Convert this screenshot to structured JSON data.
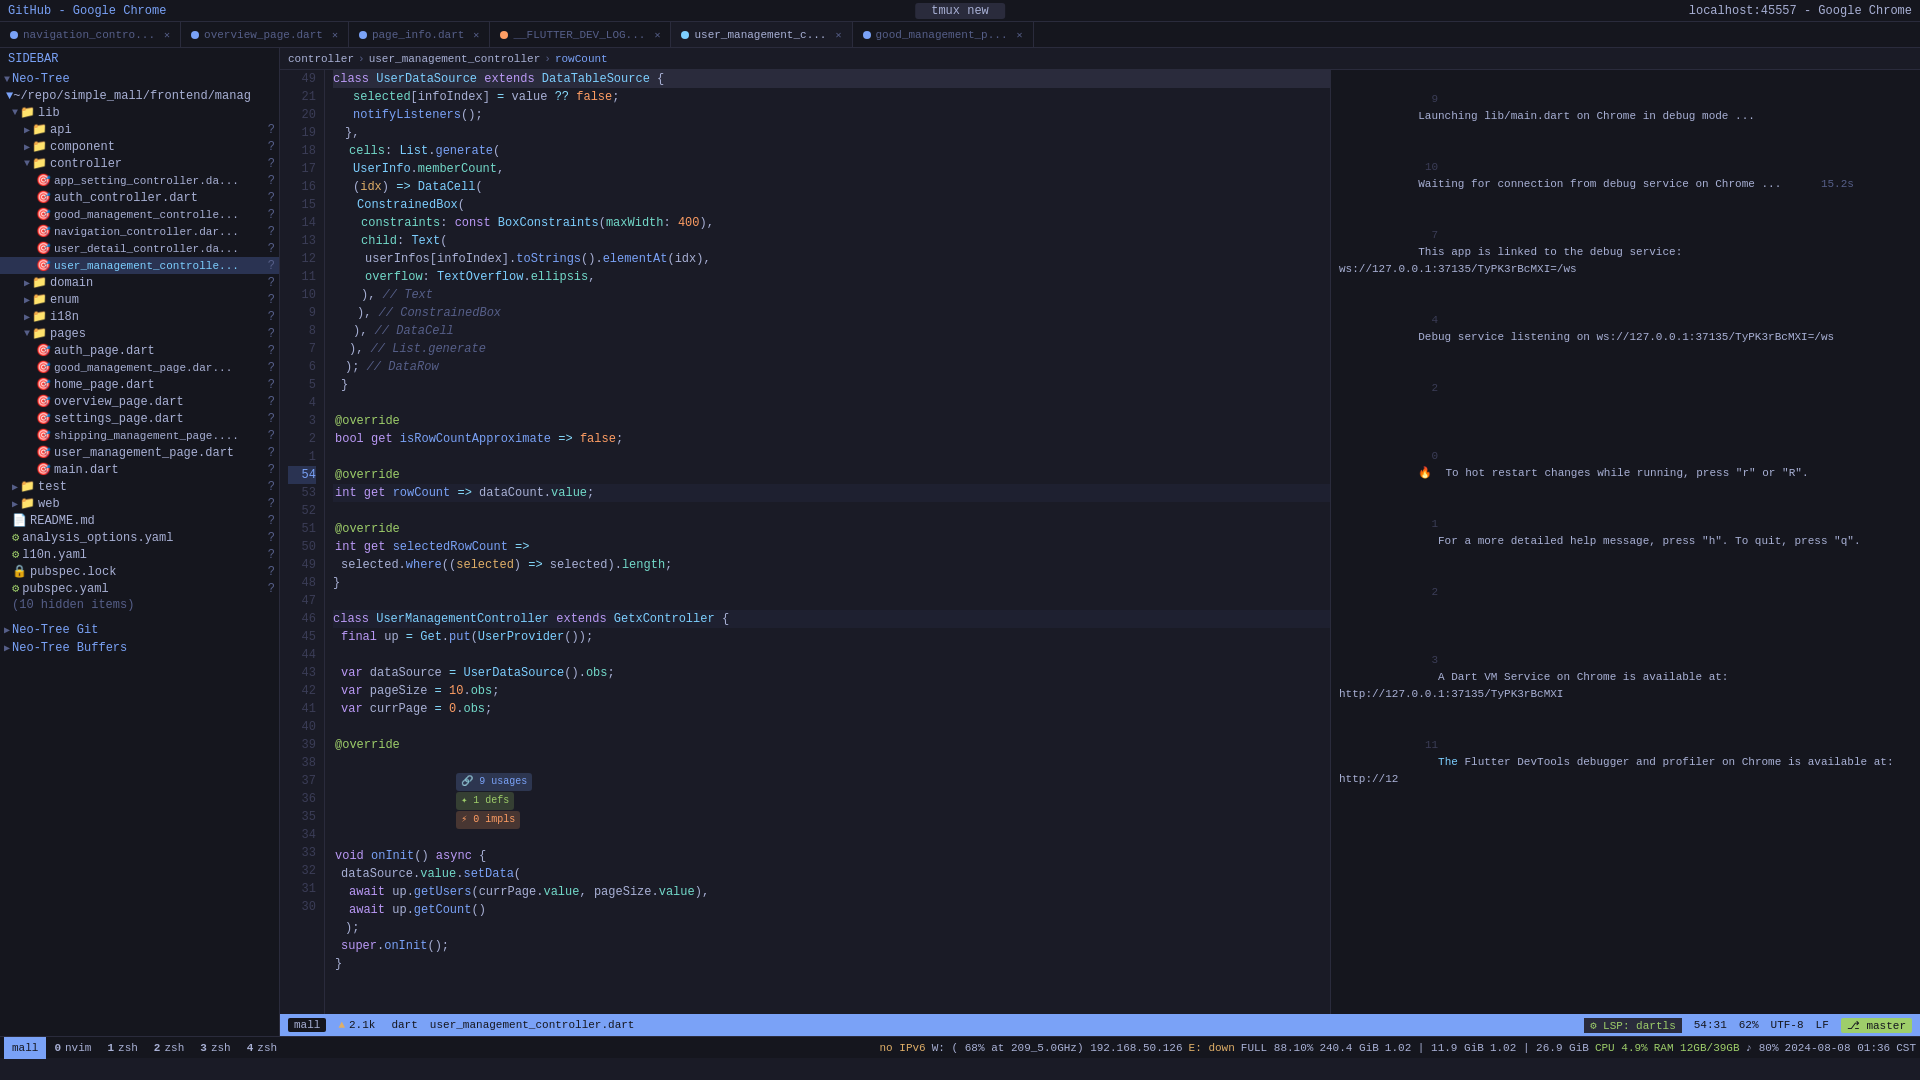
{
  "window": {
    "title_left": "GitHub - Google Chrome",
    "title_center": "tmux new",
    "title_right": "localhost:45557 - Google Chrome"
  },
  "tabs": [
    {
      "id": "nav_ctrl",
      "label": "navigation_contro...",
      "dot": "blue",
      "active": false
    },
    {
      "id": "overview",
      "label": "overview_page.dart",
      "dot": "blue",
      "active": false
    },
    {
      "id": "page_info",
      "label": "page_info.dart",
      "dot": "blue",
      "active": false
    },
    {
      "id": "flutter_dev",
      "label": "__FLUTTER_DEV_LOG...",
      "dot": "orange",
      "active": false
    },
    {
      "id": "user_mgmt_c",
      "label": "user_management_c...",
      "dot": "active",
      "active": true
    },
    {
      "id": "good_mgmt",
      "label": "good_management_p...",
      "dot": "blue",
      "active": false
    }
  ],
  "sidebar": {
    "header": "Sidebar",
    "tree_header": "Neo-Tree",
    "git_section": "Neo-Tree Git",
    "buffer_section": "Neo-Tree Buffers",
    "root": "~/repo/simple_mall/frontend/manag",
    "items": [
      {
        "level": 1,
        "label": "lib",
        "type": "folder",
        "expanded": true
      },
      {
        "level": 2,
        "label": "api",
        "type": "folder",
        "expanded": false,
        "q": true
      },
      {
        "level": 2,
        "label": "component",
        "type": "folder",
        "expanded": false,
        "q": true
      },
      {
        "level": 2,
        "label": "controller",
        "type": "folder",
        "expanded": true,
        "q": true
      },
      {
        "level": 3,
        "label": "app_setting_controller.da...",
        "type": "dart",
        "q": true
      },
      {
        "level": 3,
        "label": "auth_controller.dart",
        "type": "dart",
        "q": true
      },
      {
        "level": 3,
        "label": "good_management_controlle...",
        "type": "dart",
        "q": true
      },
      {
        "level": 3,
        "label": "navigation_controller.dar...",
        "type": "dart",
        "q": true
      },
      {
        "level": 3,
        "label": "user_detail_controller.da...",
        "type": "dart",
        "q": true
      },
      {
        "level": 3,
        "label": "user_management_controlle...",
        "type": "dart",
        "active": true,
        "q": true
      },
      {
        "level": 2,
        "label": "domain",
        "type": "folder",
        "expanded": false,
        "q": true
      },
      {
        "level": 2,
        "label": "enum",
        "type": "folder",
        "expanded": false,
        "q": true
      },
      {
        "level": 2,
        "label": "i18n",
        "type": "folder",
        "expanded": false,
        "q": true
      },
      {
        "level": 2,
        "label": "pages",
        "type": "folder",
        "expanded": true,
        "q": true
      },
      {
        "level": 3,
        "label": "auth_page.dart",
        "type": "dart",
        "q": true
      },
      {
        "level": 3,
        "label": "good_management_page.dar...",
        "type": "dart",
        "q": true
      },
      {
        "level": 3,
        "label": "home_page.dart",
        "type": "dart",
        "q": true
      },
      {
        "level": 3,
        "label": "overview_page.dart",
        "type": "dart",
        "q": true
      },
      {
        "level": 3,
        "label": "settings_page.dart",
        "type": "dart",
        "q": true
      },
      {
        "level": 3,
        "label": "shipping_management_page....",
        "type": "dart",
        "q": true
      },
      {
        "level": 3,
        "label": "user_management_page.dart",
        "type": "dart",
        "q": true
      },
      {
        "level": 2,
        "label": "main.dart",
        "type": "dart",
        "q": true
      },
      {
        "level": 1,
        "label": "test",
        "type": "folder",
        "expanded": false,
        "q": true
      },
      {
        "level": 1,
        "label": "web",
        "type": "folder",
        "expanded": false,
        "q": true
      },
      {
        "level": 1,
        "label": "README.md",
        "type": "md",
        "q": true
      },
      {
        "level": 1,
        "label": "analysis_options.yaml",
        "type": "yaml",
        "q": true
      },
      {
        "level": 1,
        "label": "l10n.yaml",
        "type": "yaml",
        "q": true
      },
      {
        "level": 1,
        "label": "pubspec.lock",
        "type": "lock",
        "q": true
      },
      {
        "level": 1,
        "label": "pubspec.yaml",
        "type": "yaml",
        "q": true
      },
      {
        "level": 0,
        "label": "(10 hidden items)",
        "type": "info"
      }
    ]
  },
  "breadcrumb": {
    "controller": "controller",
    "user_management": "user_management_controller",
    "rowCount": "rowCount"
  },
  "editor": {
    "filename": "user_management_controller.dart",
    "cursor_line": 54,
    "cursor_col": 31,
    "scroll_percent": 62
  },
  "code_lines": [
    {
      "num": 9,
      "content": "selected[infoIndex] = value ?? false;"
    },
    {
      "num": 21,
      "content": "notifyListeners();"
    },
    {
      "num": 20,
      "content": "},"
    },
    {
      "num": 19,
      "content": "cells: List.generate("
    },
    {
      "num": 18,
      "content": "UserInfo.memberCount,"
    },
    {
      "num": 17,
      "content": "(idx) => DataCell("
    },
    {
      "num": 16,
      "content": "ConstrainedBox("
    },
    {
      "num": 15,
      "content": "constraints: const BoxConstraints(maxWidth: 400),"
    },
    {
      "num": 14,
      "content": "child: Text("
    },
    {
      "num": 13,
      "content": "userInfos[infoIndex].toStrings().elementAt(idx),"
    },
    {
      "num": 12,
      "content": "overflow: TextOverflow.ellipsis,"
    },
    {
      "num": 11,
      "content": "), // Text"
    },
    {
      "num": 10,
      "content": "), // ConstrainedBox"
    },
    {
      "num": 9,
      "content": "), // DataCell"
    },
    {
      "num": 8,
      "content": "), // List.generate"
    },
    {
      "num": 7,
      "content": "); // DataRow"
    },
    {
      "num": 6,
      "content": "}"
    },
    {
      "num": 5,
      "content": ""
    },
    {
      "num": 4,
      "content": "@override"
    },
    {
      "num": 3,
      "content": "bool get isRowCountApproximate => false;"
    },
    {
      "num": 2,
      "content": ""
    },
    {
      "num": 1,
      "content": "@override"
    },
    {
      "num": 54,
      "content": "int get rowCount => dataCount.value;"
    },
    {
      "num": 53,
      "content": ""
    },
    {
      "num": 52,
      "content": "@override"
    },
    {
      "num": 51,
      "content": "int get selectedRowCount =>"
    },
    {
      "num": 50,
      "content": "selected.where((selected) => selected).length;"
    },
    {
      "num": 49,
      "content": "}"
    },
    {
      "num": 48,
      "content": ""
    },
    {
      "num": 47,
      "content": "class UserManagementController extends GetxController {"
    },
    {
      "num": 46,
      "content": "final up = Get.put(UserProvider());"
    },
    {
      "num": 45,
      "content": ""
    },
    {
      "num": 44,
      "content": "var dataSource = UserDataSource().obs;"
    },
    {
      "num": 43,
      "content": "var pageSize = 10.obs;"
    },
    {
      "num": 42,
      "content": "var currPage = 0.obs;"
    },
    {
      "num": 41,
      "content": ""
    },
    {
      "num": 40,
      "content": "@override"
    },
    {
      "num": 39,
      "content": "// 9 usages  1 defs  0 impls"
    },
    {
      "num": 38,
      "content": "void onInit() async {"
    },
    {
      "num": 37,
      "content": "dataSource.value.setData("
    },
    {
      "num": 36,
      "content": "await up.getUsers(currPage.value, pageSize.value),"
    },
    {
      "num": 35,
      "content": "await up.getCount()"
    },
    {
      "num": 34,
      "content": ");"
    },
    {
      "num": 33,
      "content": "super.onInit();"
    },
    {
      "num": 32,
      "content": "}"
    },
    {
      "num": 31,
      "content": ""
    }
  ],
  "terminal": {
    "lines": [
      {
        "num": 9,
        "text": "Launching lib/main.dart on Chrome in debug mode ...",
        "color": "normal"
      },
      {
        "num": 10,
        "text": "Waiting for connection from debug service on Chrome ...       15.2s",
        "color": "normal"
      },
      {
        "num": 7,
        "text": "This app is linked to the debug service: ws://127.0.0.1:37135/TyPK3rBcMXI=/ws",
        "color": "normal"
      },
      {
        "num": 4,
        "text": "Debug service listening on ws://127.0.0.1:37135/TyPK3rBcMXI=/ws",
        "color": "normal"
      },
      {
        "num": 2,
        "text": ""
      },
      {
        "num": 0,
        "text": "🔥  To hot restart changes while running, press \"r\" or \"R\".",
        "color": "normal"
      },
      {
        "num": 1,
        "text": "   For a more detailed help message, press \"h\". To quit, press \"q\".",
        "color": "normal"
      },
      {
        "num": 2,
        "text": ""
      },
      {
        "num": 3,
        "text": "   A Dart VM Service on Chrome is available at: http://127.0.0.1:37135/TyPK3rBcMXI",
        "color": "normal"
      },
      {
        "num": 11,
        "text": "   The Flutter DevTools debugger and profiler on Chrome is available at: http://12",
        "color": "normal"
      }
    ]
  },
  "status_bar": {
    "branch": "master",
    "errors": "▲ 2.1k",
    "language": "dart",
    "filename": "user_management_controller.dart",
    "cursor": "54:31",
    "scroll": "62%",
    "lsp": "LSP: dartls",
    "encoding": "UTF-8",
    "line_ending": "LF",
    "git_icon": "⎇",
    "git_branch": "master"
  },
  "tmux_bar": {
    "panes": [
      {
        "id": "mall",
        "label": "mall",
        "active": true,
        "num": ""
      },
      {
        "id": "nvim",
        "label": "nvim",
        "active": false,
        "num": "0"
      },
      {
        "id": "zsh1",
        "label": "zsh",
        "active": false,
        "num": "1"
      },
      {
        "id": "zsh2",
        "label": "zsh",
        "active": false,
        "num": "2"
      },
      {
        "id": "zsh3",
        "label": "zsh",
        "active": false,
        "num": "3"
      },
      {
        "id": "zsh4",
        "label": "zsh",
        "active": false,
        "num": "4"
      }
    ],
    "right_info": "no IPv6 H  W: ( 68% at 209_5.0GHz) 192.168.50.126 | E: down | FULL 88.10% | 240.4 GiB 1.02 | 11.9 GiB 1.02 | 26.9 GiB",
    "cpu": "CPU 4.9%",
    "ram": "RAM 12GB/39GB",
    "date": "2024-08-08 01:36",
    "time": "CST"
  },
  "class_header": "class UserDataSource extends DataTableSource {"
}
